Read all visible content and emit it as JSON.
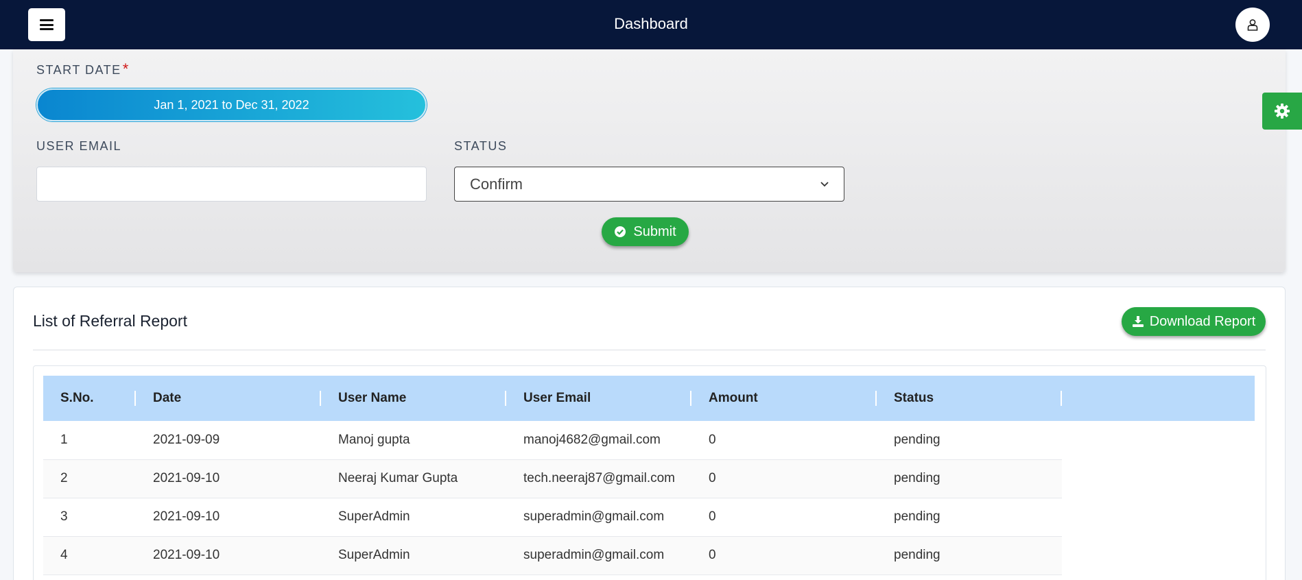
{
  "header": {
    "title": "Dashboard"
  },
  "filters": {
    "start_date_label": "START DATE",
    "required_mark": "*",
    "date_range": "Jan 1, 2021 to Dec 31, 2022",
    "user_email_label": "USER EMAIL",
    "user_email_value": "",
    "status_label": "STATUS",
    "status_selected": "Confirm",
    "submit_label": "Submit"
  },
  "report": {
    "title": "List of Referral Report",
    "download_label": "Download Report",
    "columns": [
      "S.No.",
      "Date",
      "User Name",
      "User Email",
      "Amount",
      "Status"
    ],
    "rows": [
      [
        "1",
        "2021-09-09",
        "Manoj gupta",
        "manoj4682@gmail.com",
        "0",
        "pending"
      ],
      [
        "2",
        "2021-09-10",
        "Neeraj Kumar Gupta",
        "tech.neeraj87@gmail.com",
        "0",
        "pending"
      ],
      [
        "3",
        "2021-09-10",
        "SuperAdmin",
        "superadmin@gmail.com",
        "0",
        "pending"
      ],
      [
        "4",
        "2021-09-10",
        "SuperAdmin",
        "superadmin@gmail.com",
        "0",
        "pending"
      ]
    ]
  },
  "colors": {
    "navbar": "#07173a",
    "accent_green": "#28a745",
    "table_header": "#b9dafb",
    "date_pill": "#0a86d0"
  },
  "icons": [
    "hamburger-menu-icon",
    "user-icon",
    "check-circle-icon",
    "gear-icon",
    "download-icon",
    "chevron-down-icon"
  ]
}
